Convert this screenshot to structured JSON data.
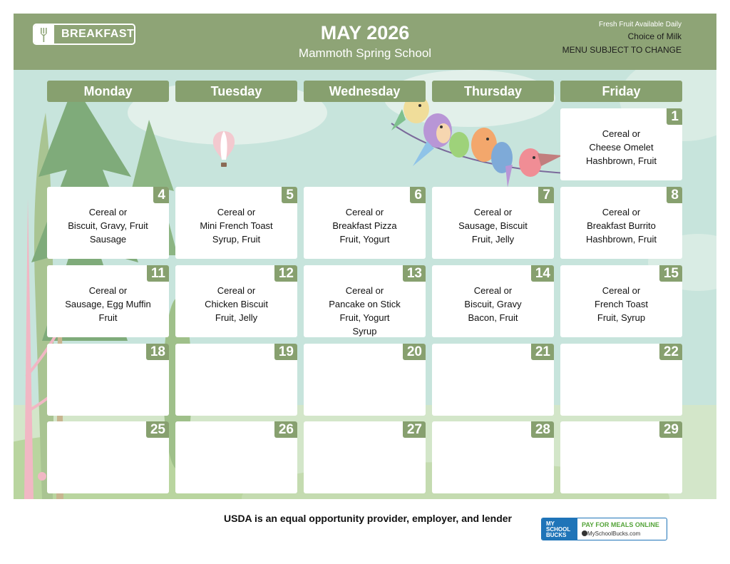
{
  "header": {
    "logo_label": "BREAKFAST",
    "title": "MAY 2026",
    "school": "Mammoth Spring School",
    "note_fruit": "Fresh Fruit Available Daily",
    "note_milk": "Choice of Milk",
    "note_change": "MENU SUBJECT TO CHANGE"
  },
  "days": [
    "Monday",
    "Tuesday",
    "Wednesday",
    "Thursday",
    "Friday"
  ],
  "calendar": [
    {
      "day": "1",
      "lines": [
        "Cereal or",
        "Cheese Omelet",
        "Hashbrown, Fruit"
      ]
    },
    {
      "day": "4",
      "lines": [
        "Cereal or",
        "Biscuit, Gravy, Fruit",
        "Sausage"
      ]
    },
    {
      "day": "5",
      "lines": [
        "Cereal or",
        "Mini French Toast",
        "Syrup, Fruit"
      ]
    },
    {
      "day": "6",
      "lines": [
        "Cereal or",
        "Breakfast Pizza",
        "Fruit, Yogurt"
      ]
    },
    {
      "day": "7",
      "lines": [
        "Cereal or",
        "Sausage, Biscuit",
        "Fruit, Jelly"
      ]
    },
    {
      "day": "8",
      "lines": [
        "Cereal or",
        "Breakfast Burrito",
        "Hashbrown, Fruit"
      ]
    },
    {
      "day": "11",
      "lines": [
        "Cereal or",
        "Sausage, Egg Muffin",
        "Fruit"
      ]
    },
    {
      "day": "12",
      "lines": [
        "Cereal or",
        "Chicken Biscuit",
        "Fruit, Jelly"
      ]
    },
    {
      "day": "13",
      "lines": [
        "Cereal or",
        "Pancake on Stick",
        "Fruit, Yogurt",
        "Syrup"
      ]
    },
    {
      "day": "14",
      "lines": [
        "Cereal or",
        "Biscuit, Gravy",
        "Bacon, Fruit"
      ]
    },
    {
      "day": "15",
      "lines": [
        "Cereal or",
        "French Toast",
        "Fruit, Syrup"
      ]
    },
    {
      "day": "18",
      "lines": []
    },
    {
      "day": "19",
      "lines": []
    },
    {
      "day": "20",
      "lines": []
    },
    {
      "day": "21",
      "lines": []
    },
    {
      "day": "22",
      "lines": []
    },
    {
      "day": "25",
      "lines": []
    },
    {
      "day": "26",
      "lines": []
    },
    {
      "day": "27",
      "lines": []
    },
    {
      "day": "28",
      "lines": []
    },
    {
      "day": "29",
      "lines": []
    }
  ],
  "footer": {
    "usda": "USDA is an equal opportunity provider, employer, and lender",
    "msb_brand": "MY SCHOOL BUCKS",
    "msb_pay": "PAY FOR MEALS ONLINE",
    "msb_url": "MySchoolBucks.com"
  },
  "colors": {
    "header_bg": "#8ea476",
    "day_header": "#87a06f",
    "background_sky": "#c7e4dc",
    "msb_blue": "#1f74b8",
    "msb_green": "#55a43a"
  },
  "icons": [
    "fork-icon",
    "hot-air-balloon-icon",
    "birds-on-branch-illustration",
    "trees-illustration"
  ]
}
